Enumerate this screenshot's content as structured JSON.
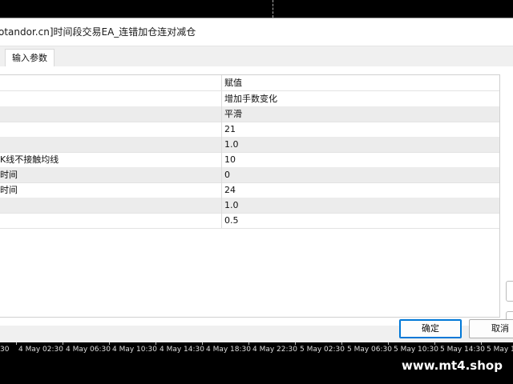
{
  "window": {
    "title": "otandor.cn]时间段交易EA_连错加仓连对减仓"
  },
  "tabs": [
    {
      "label": "输入参数"
    }
  ],
  "params": {
    "header_value": "赋值",
    "rows": [
      {
        "name": "",
        "value": "增加手数变化"
      },
      {
        "name": "",
        "value": "平滑"
      },
      {
        "name": "",
        "value": "21"
      },
      {
        "name": "",
        "value": "1.0"
      },
      {
        "name": "K线不接触均线",
        "value": "10"
      },
      {
        "name": "时间",
        "value": "0"
      },
      {
        "name": "时间",
        "value": "24"
      },
      {
        "name": "",
        "value": "1.0"
      },
      {
        "name": "",
        "value": "0.5"
      }
    ]
  },
  "buttons": {
    "ok": "确定",
    "cancel": "取消"
  },
  "axis_ticks": [
    "30",
    "4 May 02:30",
    "4 May 06:30",
    "4 May 10:30",
    "4 May 14:30",
    "4 May 18:30",
    "4 May 22:30",
    "5 May 02:30",
    "5 May 06:30",
    "5 May 10:30",
    "5 May 14:30",
    "5 May 18"
  ],
  "watermark": "www.mt4.shop",
  "colors": {
    "accent": "#0078d7",
    "chart_bg": "#000000",
    "dialog_bg": "#f0f0f0"
  }
}
